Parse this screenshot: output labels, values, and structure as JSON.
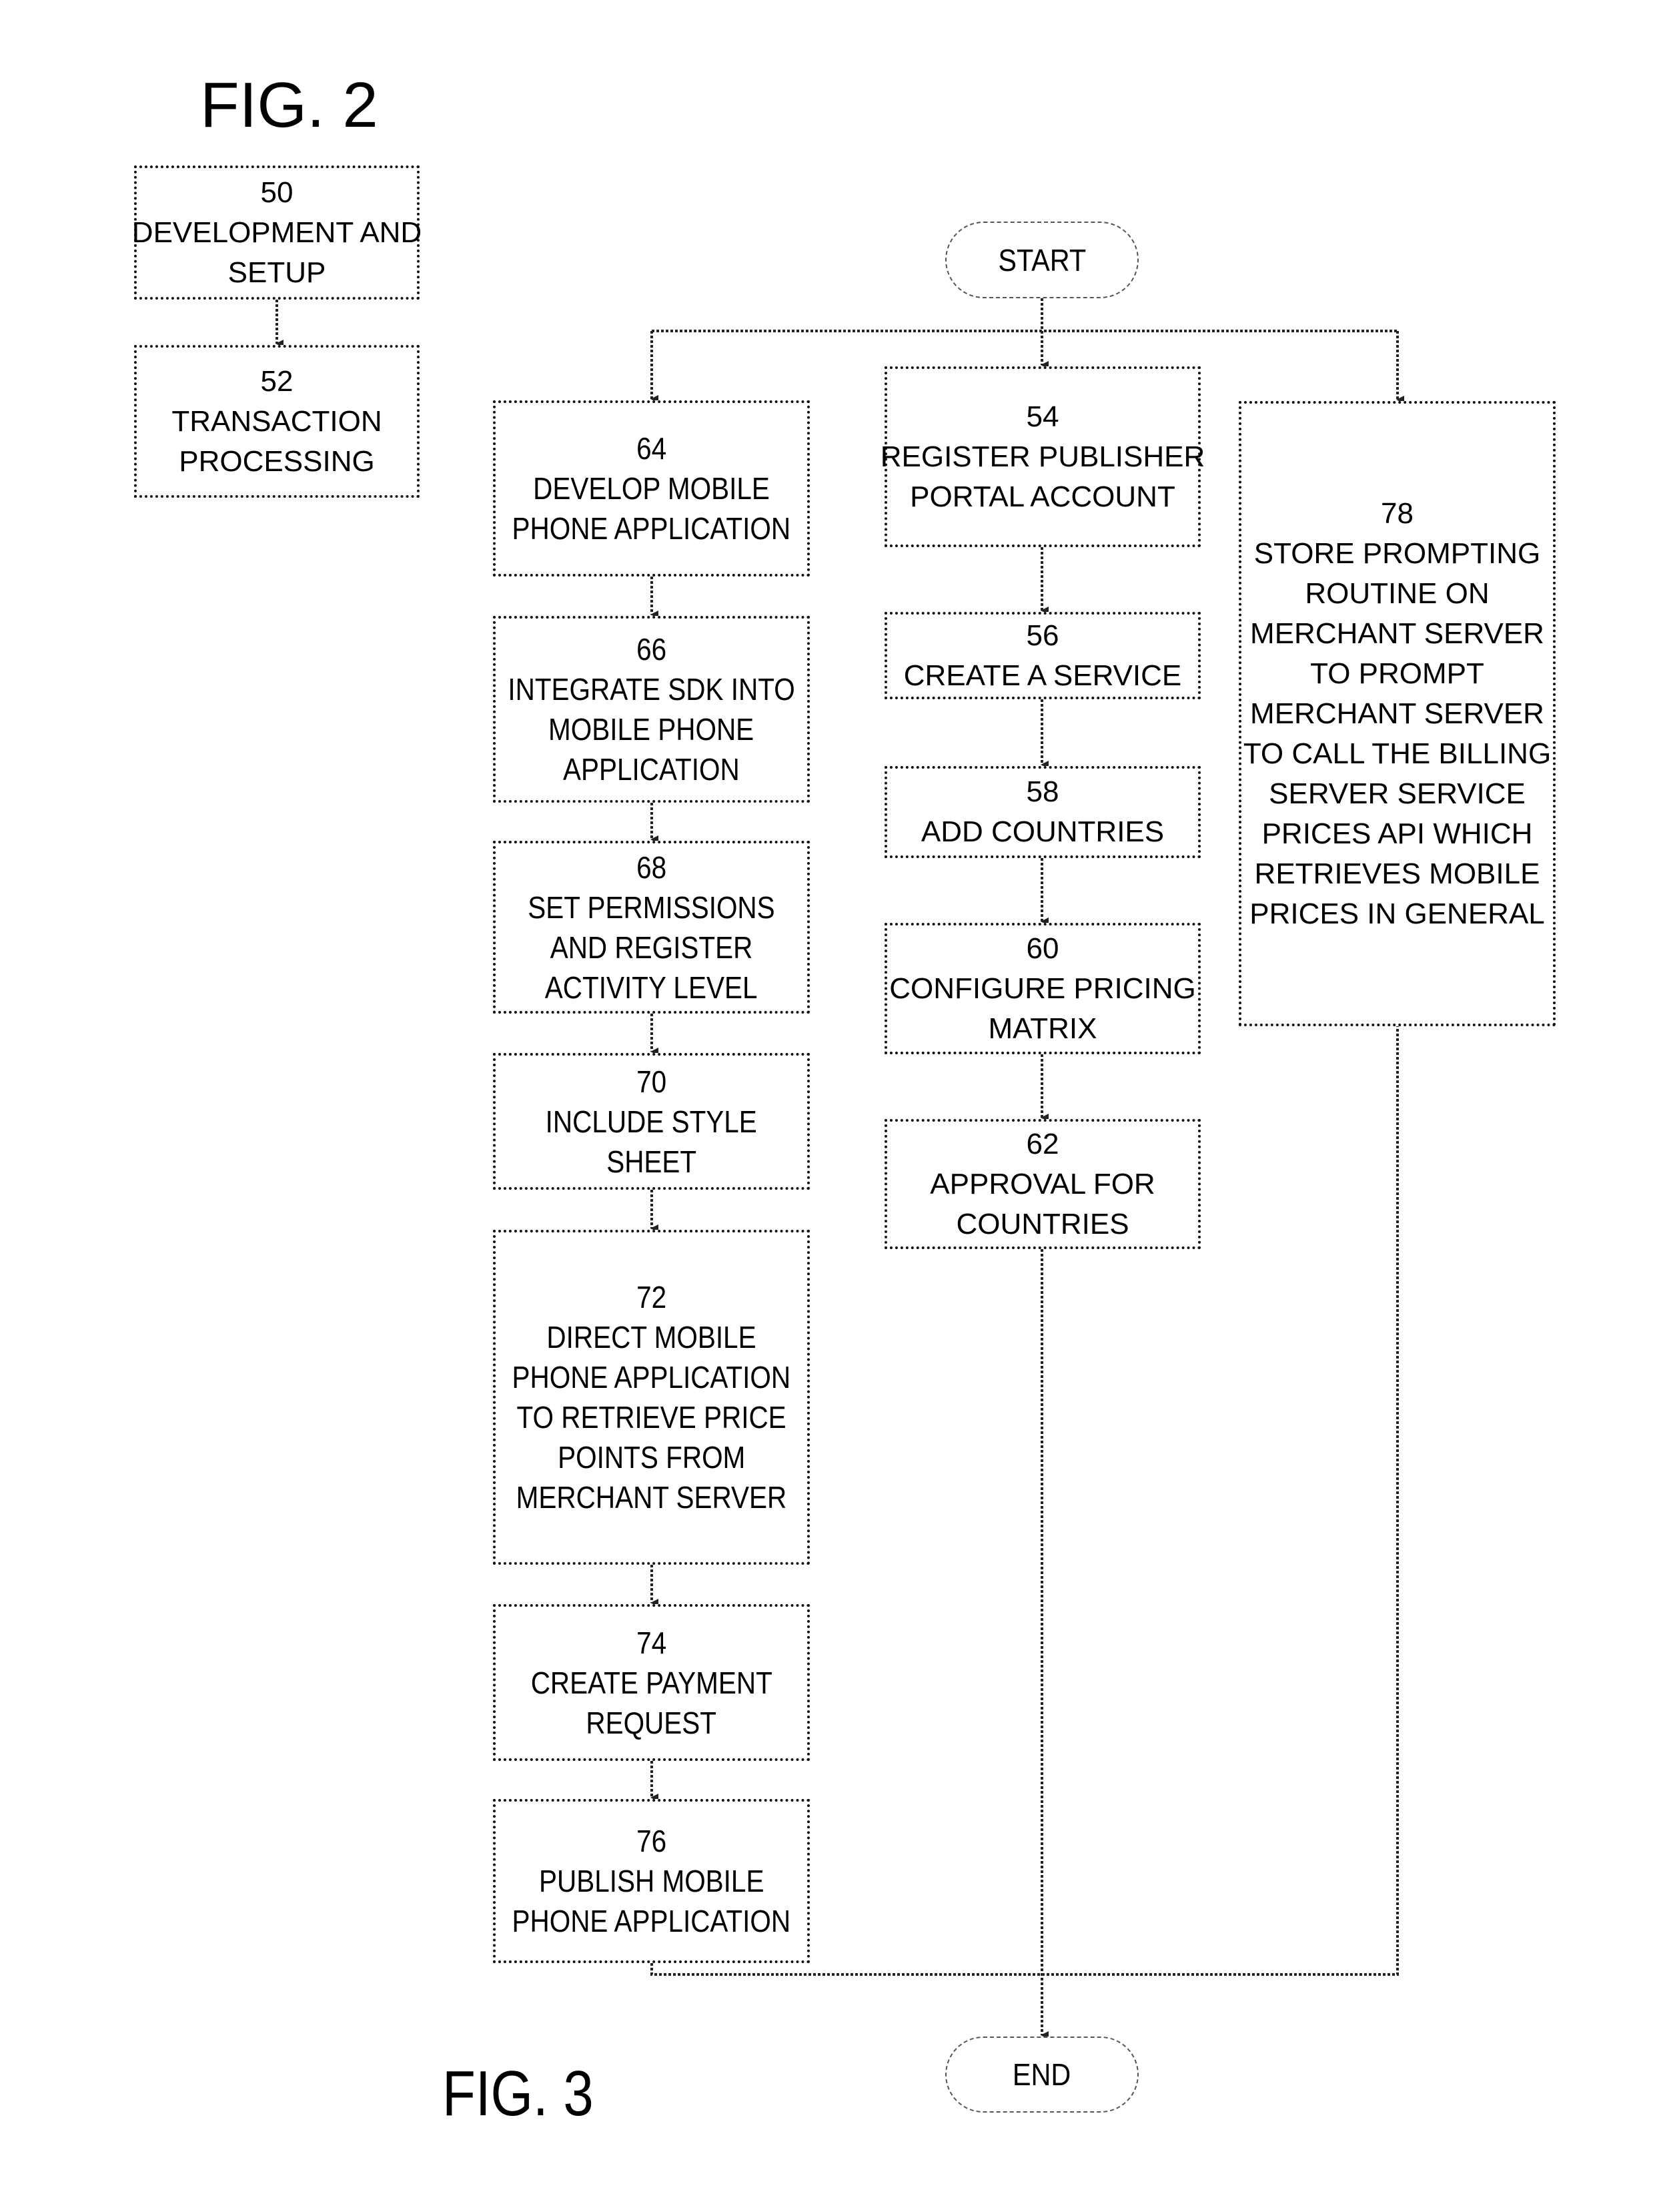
{
  "fig2": {
    "title": "FIG. 2",
    "boxes": [
      {
        "ref": "50",
        "lines": [
          "DEVELOPMENT AND",
          "SETUP"
        ]
      },
      {
        "ref": "52",
        "lines": [
          "TRANSACTION",
          "PROCESSING"
        ]
      }
    ]
  },
  "fig3": {
    "title": "FIG. 3",
    "start_label": "START",
    "end_label": "END",
    "left_column": [
      {
        "ref": "64",
        "lines": [
          "DEVELOP MOBILE",
          "PHONE APPLICATION"
        ]
      },
      {
        "ref": "66",
        "lines": [
          "INTEGRATE SDK INTO",
          "MOBILE PHONE",
          "APPLICATION"
        ]
      },
      {
        "ref": "68",
        "lines": [
          "SET PERMISSIONS",
          "AND REGISTER",
          "ACTIVITY LEVEL"
        ]
      },
      {
        "ref": "70",
        "lines": [
          "INCLUDE STYLE",
          "SHEET"
        ]
      },
      {
        "ref": "72",
        "lines": [
          "DIRECT MOBILE",
          "PHONE APPLICATION",
          "TO RETRIEVE PRICE",
          "POINTS FROM",
          "MERCHANT SERVER"
        ]
      },
      {
        "ref": "74",
        "lines": [
          "CREATE PAYMENT",
          "REQUEST"
        ]
      },
      {
        "ref": "76",
        "lines": [
          "PUBLISH MOBILE",
          "PHONE APPLICATION"
        ]
      }
    ],
    "middle_column": [
      {
        "ref": "54",
        "lines": [
          "REGISTER PUBLISHER",
          "PORTAL ACCOUNT"
        ]
      },
      {
        "ref": "56",
        "lines": [
          "CREATE A SERVICE"
        ]
      },
      {
        "ref": "58",
        "lines": [
          "ADD COUNTRIES"
        ]
      },
      {
        "ref": "60",
        "lines": [
          "CONFIGURE PRICING",
          "MATRIX"
        ]
      },
      {
        "ref": "62",
        "lines": [
          "APPROVAL FOR",
          "COUNTRIES"
        ]
      }
    ],
    "right_column": [
      {
        "ref": "78",
        "lines": [
          "STORE PROMPTING",
          "ROUTINE ON",
          "MERCHANT SERVER",
          "TO PROMPT",
          "MERCHANT SERVER",
          "TO CALL THE BILLING",
          "SERVER SERVICE",
          "PRICES API WHICH",
          "RETRIEVES MOBILE",
          "PRICES IN GENERAL"
        ]
      }
    ]
  }
}
